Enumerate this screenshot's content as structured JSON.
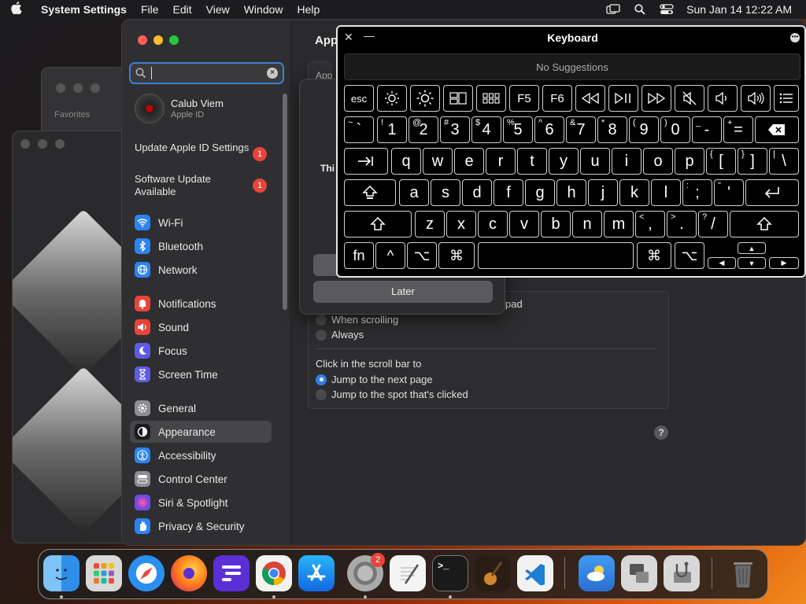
{
  "menubar": {
    "app_name": "System Settings",
    "menus": [
      "File",
      "Edit",
      "View",
      "Window",
      "Help"
    ],
    "datetime": "Sun Jan 14  12:22 AM"
  },
  "background": {
    "favorites_label": "Favorites"
  },
  "settings": {
    "search": {
      "value": "",
      "placeholder": ""
    },
    "profile": {
      "name": "Calub Viem",
      "subtitle": "Apple ID"
    },
    "notices": [
      {
        "label": "Update Apple ID Settings",
        "badge": "1"
      },
      {
        "label": "Software Update Available",
        "badge": "1"
      }
    ],
    "sidebar": {
      "group1": [
        {
          "label": "Wi-Fi",
          "icon": "wifi-icon",
          "color": "#2a84f5"
        },
        {
          "label": "Bluetooth",
          "icon": "bluetooth-icon",
          "color": "#2a84f5"
        },
        {
          "label": "Network",
          "icon": "globe-icon",
          "color": "#2a84f5"
        }
      ],
      "group2": [
        {
          "label": "Notifications",
          "icon": "bell-icon",
          "color": "#e8443a"
        },
        {
          "label": "Sound",
          "icon": "speaker-icon",
          "color": "#e8443a"
        },
        {
          "label": "Focus",
          "icon": "moon-icon",
          "color": "#5e5ce6"
        },
        {
          "label": "Screen Time",
          "icon": "hourglass-icon",
          "color": "#5e5ce6"
        }
      ],
      "group3": [
        {
          "label": "General",
          "icon": "gear-icon",
          "color": "#8e8e93"
        },
        {
          "label": "Appearance",
          "icon": "appearance-icon",
          "color": "#1c1c1e",
          "active": true
        },
        {
          "label": "Accessibility",
          "icon": "accessibility-icon",
          "color": "#2a84f5"
        },
        {
          "label": "Control Center",
          "icon": "control-center-icon",
          "color": "#8e8e93"
        },
        {
          "label": "Siri & Spotlight",
          "icon": "siri-icon",
          "color": "#c94fd6"
        },
        {
          "label": "Privacy & Security",
          "icon": "hand-icon",
          "color": "#2a84f5"
        }
      ]
    },
    "content": {
      "title": "App",
      "panel_label": "App",
      "show_scroll_suffix": "ckpad",
      "scroll_options": [
        "When scrolling",
        "Always"
      ],
      "click_heading": "Click in the scroll bar to",
      "click_options": [
        {
          "label": "Jump to the next page",
          "selected": true
        },
        {
          "label": "Jump to the spot that's clicked",
          "selected": false
        }
      ],
      "help": "?"
    },
    "sheet": {
      "text": "Thi",
      "later_button": "Later"
    }
  },
  "keyboard": {
    "title": "Keyboard",
    "suggestions": "No Suggestions",
    "row_fn": [
      "esc",
      "F5",
      "F6"
    ],
    "row_numbers": [
      {
        "shift": "~",
        "main": "`"
      },
      {
        "shift": "!",
        "main": "1"
      },
      {
        "shift": "@",
        "main": "2"
      },
      {
        "shift": "#",
        "main": "3"
      },
      {
        "shift": "$",
        "main": "4"
      },
      {
        "shift": "%",
        "main": "5"
      },
      {
        "shift": "^",
        "main": "6"
      },
      {
        "shift": "&",
        "main": "7"
      },
      {
        "shift": "*",
        "main": "8"
      },
      {
        "shift": "(",
        "main": "9"
      },
      {
        "shift": ")",
        "main": "0"
      },
      {
        "shift": "_",
        "main": "-"
      },
      {
        "shift": "+",
        "main": "="
      }
    ],
    "row_q": [
      "q",
      "w",
      "e",
      "r",
      "t",
      "y",
      "u",
      "i",
      "o",
      "p"
    ],
    "row_q_extra": [
      {
        "shift": "{",
        "main": "["
      },
      {
        "shift": "}",
        "main": "]"
      },
      {
        "shift": "|",
        "main": "\\"
      }
    ],
    "row_a": [
      "a",
      "s",
      "d",
      "f",
      "g",
      "h",
      "j",
      "k",
      "l"
    ],
    "row_a_extra": [
      {
        "shift": ":",
        "main": ";"
      },
      {
        "shift": "\"",
        "main": "'"
      }
    ],
    "row_z": [
      "z",
      "x",
      "c",
      "v",
      "b",
      "n",
      "m"
    ],
    "row_z_extra": [
      {
        "shift": "<",
        "main": ","
      },
      {
        "shift": ">",
        "main": "."
      },
      {
        "shift": "?",
        "main": "/"
      }
    ],
    "row_bottom": {
      "fn": "fn",
      "control": "^",
      "option": "⌥",
      "command": "⌘"
    }
  },
  "dock": {
    "apps": [
      {
        "name": "Finder",
        "icon": "finder-icon",
        "color": "#2f8fe8"
      },
      {
        "name": "Launchpad",
        "icon": "launchpad-icon",
        "color": "#d8d8d8"
      },
      {
        "name": "Safari",
        "icon": "safari-icon",
        "color": "#2a8ff0"
      },
      {
        "name": "Firefox",
        "icon": "firefox-icon",
        "color": "#ff7a1a"
      },
      {
        "name": "FileZilla-like",
        "icon": "f-app-icon",
        "color": "#5b2fd6"
      },
      {
        "name": "Chrome",
        "icon": "chrome-icon",
        "color": "#f2f2f2"
      },
      {
        "name": "App Store",
        "icon": "appstore-icon",
        "color": "#1e8bf5"
      },
      {
        "name": "System Settings",
        "icon": "settings-icon",
        "color": "#8a8a8e",
        "badge": "2"
      },
      {
        "name": "TextEdit",
        "icon": "textedit-icon",
        "color": "#f4f4f4"
      },
      {
        "name": "Terminal",
        "icon": "terminal-icon",
        "color": "#1a1a1a"
      },
      {
        "name": "GarageBand",
        "icon": "guitar-icon",
        "color": "#3a2a1c"
      },
      {
        "name": "VS Code",
        "icon": "vscode-icon",
        "color": "#f2f2f2"
      },
      {
        "name": "Weather",
        "icon": "weather-icon",
        "color": "#2a7fd8"
      },
      {
        "name": "Migration Assistant",
        "icon": "migration-icon",
        "color": "#d8d8d8"
      },
      {
        "name": "Disk Utility",
        "icon": "disk-utility-icon",
        "color": "#d8d8d8"
      },
      {
        "name": "Trash",
        "icon": "trash-icon",
        "color": "#6a6a6a"
      }
    ],
    "terminal_glyph": ">_"
  }
}
